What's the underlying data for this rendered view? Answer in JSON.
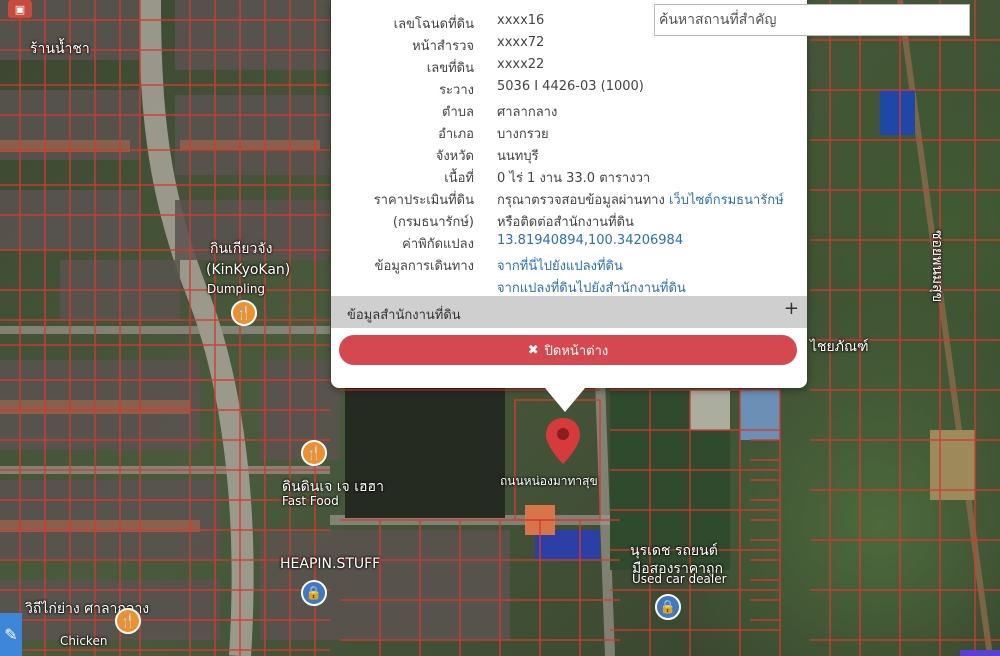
{
  "popup": {
    "rows": [
      {
        "label": "เลขโฉนดที่ดิน",
        "value": "xxxx16"
      },
      {
        "label": "หน้าสำรวจ",
        "value": "xxxx72"
      },
      {
        "label": "เลขที่ดิน",
        "value": "xxxx22"
      },
      {
        "label": "ระวาง",
        "value": "5036 I 4426-03 (1000)"
      },
      {
        "label": "ตำบล",
        "value": "ศาลากลาง"
      },
      {
        "label": "อำเภอ",
        "value": "บางกรวย"
      },
      {
        "label": "จังหวัด",
        "value": "นนทบุรี"
      },
      {
        "label": "เนื้อที่",
        "value": "0 ไร่ 1 งาน 33.0 ตารางวา"
      },
      {
        "label": "ราคาประเมินที่ดิน",
        "value": "กรุณาตรวจสอบข้อมูลผ่านทาง",
        "link": "เว็บไซต์กรมธนารักษ์"
      },
      {
        "label": "(กรมธนารักษ์)",
        "value": "หรือติดต่อสำนักงานที่ดิน"
      },
      {
        "label": "ค่าพิกัดแปลง",
        "link": "13.81940894,100.34206984"
      },
      {
        "label": "ข้อมูลการเดินทาง",
        "link": "จากที่นี่ไปยังแปลงที่ดิน"
      },
      {
        "label": "",
        "link": "จากแปลงที่ดินไปยังสำนักงานที่ดิน"
      }
    ],
    "section_label": "ข้อมูลสำนักงานที่ดิน",
    "section_toggle": "+",
    "close_icon": "✖",
    "close_label": "ปิดหน้าต่าง"
  },
  "search": {
    "placeholder": "ค้นหาสถานที่สำคัญ",
    "value": ""
  },
  "map": {
    "labels": {
      "kinkyokan_th": "กินเกียวจัง",
      "kinkyokan_en": "(KinKyoKan)",
      "dumpling": "Dumpling",
      "fastfood_th": "ดินดินเจ เจ เฮฮา",
      "fastfood_en": "Fast Food",
      "heapin": "HEAPIN.STUFF",
      "used_car_th": "นุรเดช รถยนต์",
      "used_car_th2": "มือสองราคาถูก",
      "used_car_en": "Used car dealer",
      "chicken": "Chicken",
      "chicken_th": "วิถีไก่ย่าง ศาลากลาง",
      "top_left_th": "ร้านน้ำชา",
      "street_vertical": "ซอยพนมสุข",
      "right_place": "ไชยภัณฑ์",
      "center_road": "ถนนหน่องมาทาสุข"
    },
    "pin_color": "#d63a3a",
    "parcel_line_color": "#d33a30"
  },
  "icons": {
    "pin": "map-pin-icon",
    "food": "fork-knife-icon",
    "shop": "shopping-bag-icon",
    "tools": "tools-icon",
    "close": "close-icon",
    "plus": "plus-icon"
  }
}
